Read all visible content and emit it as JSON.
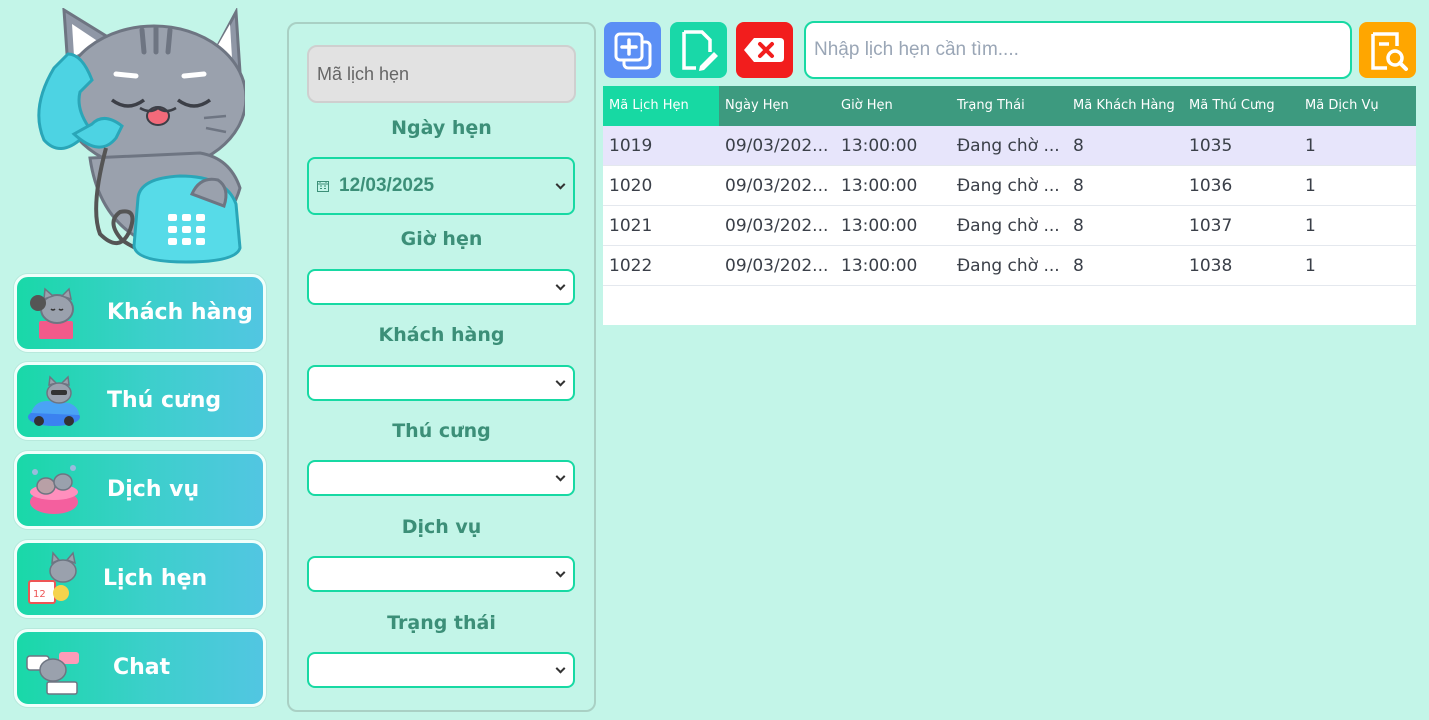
{
  "nav": {
    "items": [
      {
        "label": "Khách hàng",
        "icon": "cat-phone-icon"
      },
      {
        "label": "Thú cưng",
        "icon": "cat-car-icon"
      },
      {
        "label": "Dịch vụ",
        "icon": "cat-bath-icon"
      },
      {
        "label": "Lịch hẹn",
        "icon": "cat-calendar-icon"
      },
      {
        "label": "Chat",
        "icon": "cat-chat-icon"
      }
    ]
  },
  "form": {
    "id_placeholder": "Mã lịch hẹn",
    "date_label": "Ngày hẹn",
    "date_value": "12/03/2025",
    "time_label": "Giờ hẹn",
    "customer_label": "Khách hàng",
    "pet_label": "Thú cưng",
    "service_label": "Dịch vụ",
    "status_label": "Trạng thái"
  },
  "toolbar": {
    "search_placeholder": "Nhập lịch hẹn cần tìm...."
  },
  "table": {
    "columns": [
      "Mã Lịch Hẹn",
      "Ngày Hẹn",
      "Giờ Hẹn",
      "Trạng Thái",
      "Mã Khách Hàng",
      "Mã Thú Cưng",
      "Mã Dịch Vụ"
    ],
    "rows": [
      [
        "1019",
        "09/03/202...",
        "13:00:00",
        "Đang chờ ...",
        "8",
        "1035",
        "1"
      ],
      [
        "1020",
        "09/03/202...",
        "13:00:00",
        "Đang chờ ...",
        "8",
        "1036",
        "1"
      ],
      [
        "1021",
        "09/03/202...",
        "13:00:00",
        "Đang chờ ...",
        "8",
        "1037",
        "1"
      ],
      [
        "1022",
        "09/03/202...",
        "13:00:00",
        "Đang chờ ...",
        "8",
        "1038",
        "1"
      ]
    ]
  },
  "colors": {
    "accent": "#17d9a3",
    "header": "#3d9a7f",
    "background": "#c3f5e8",
    "add": "#5b8ff5",
    "delete": "#f21d1d",
    "search": "#ffa600"
  }
}
